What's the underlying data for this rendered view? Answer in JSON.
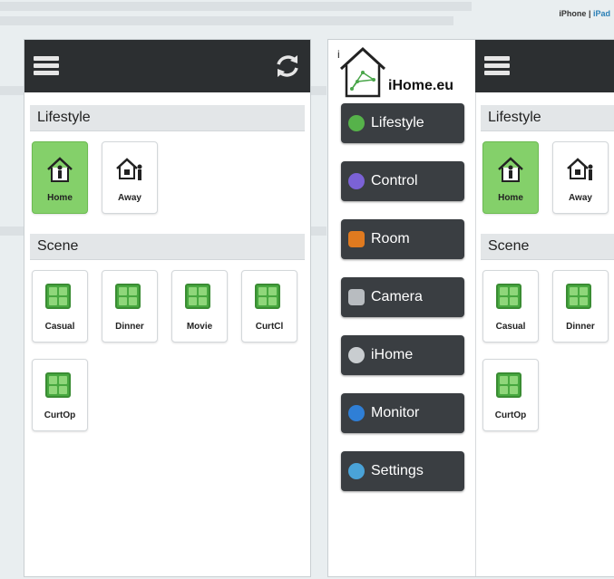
{
  "top_link": {
    "iphone": "iPhone",
    "sep": "|",
    "ipad": "iPad"
  },
  "app": {
    "sections": {
      "lifestyle": "Lifestyle",
      "scene": "Scene"
    },
    "lifestyle_tiles": [
      {
        "label": "Home",
        "icon": "home-person-icon",
        "active": true
      },
      {
        "label": "Away",
        "icon": "home-away-icon",
        "active": false
      }
    ],
    "scene_tiles": [
      {
        "label": "Casual",
        "icon": "scene-grid-icon"
      },
      {
        "label": "Dinner",
        "icon": "scene-grid-icon"
      },
      {
        "label": "Movie",
        "icon": "scene-grid-icon"
      },
      {
        "label": "CurtCl",
        "icon": "scene-grid-icon"
      },
      {
        "label": "CurtOp",
        "icon": "scene-grid-icon"
      }
    ]
  },
  "sidebar": {
    "logo_text": "iHome.eu",
    "items": [
      {
        "label": "Lifestyle",
        "icon": "home-icon",
        "color": "#56b24a"
      },
      {
        "label": "Control",
        "icon": "control-icon",
        "color": "#7b62d6"
      },
      {
        "label": "Room",
        "icon": "room-icon",
        "color": "#e07a1f"
      },
      {
        "label": "Camera",
        "icon": "camera-icon",
        "color": "#b8bcc0"
      },
      {
        "label": "iHome",
        "icon": "ihome-icon",
        "color": "#c9cdd0"
      },
      {
        "label": "Monitor",
        "icon": "info-icon",
        "color": "#2f7fd6"
      },
      {
        "label": "Settings",
        "icon": "settings-icon",
        "color": "#4aa3d8"
      }
    ]
  },
  "colors": {
    "header": "#2c2f31",
    "active_tile": "#84d06a",
    "menu_button": "#3a3e42"
  }
}
